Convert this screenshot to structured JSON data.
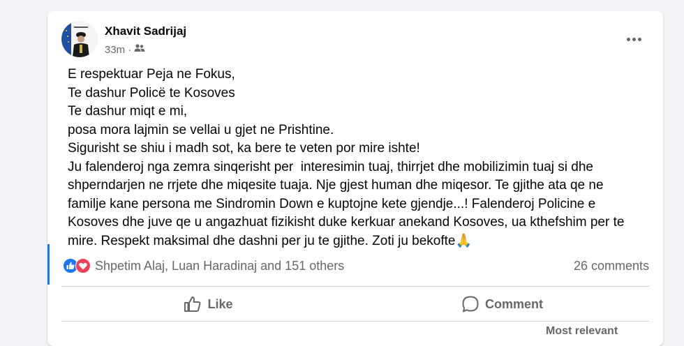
{
  "post": {
    "author": "Xhavit Sadrijaj",
    "time": "33m",
    "audience_icon": "friends-icon",
    "text_lines": [
      "E respektuar Peja ne Fokus,",
      "Te dashur Policë te Kosoves",
      "Te dashur miqt e mi,",
      "posa mora lajmin se vellai u gjet ne Prishtine.",
      "Sigurisht se shiu i madh sot, ka bere te veten por mire ishte!",
      "Ju falenderoj nga zemra sinqerisht per  interesimin tuaj, thirrjet dhe mobilizimin tuaj si dhe",
      "shperndarjen ne rrjete dhe miqesite tuaja. Nje gjest human dhe miqesor. Te gjithe ata qe ne",
      "familje kane persona me Sindromin Down e kuptojne kete gjendje...! Falenderoj Policine e",
      "Kosoves dhe juve qe u angazhuat fizikisht duke kerkuar anekand Kosoves, ua kthefshim per te",
      "mire. Respekt maksimal dhe dashni per ju te gjithe. Zoti ju bekofte🙏"
    ]
  },
  "reactions": {
    "names": "Shpetim Alaj, Luan Haradinaj and 151 others",
    "comments": "26 comments",
    "icons": [
      "like-icon",
      "love-icon"
    ]
  },
  "actions": {
    "like": "Like",
    "comment": "Comment"
  },
  "sort": {
    "label": "Most relevant"
  },
  "colors": {
    "accent": "#1877f2",
    "love": "#f33e58",
    "secondary_text": "#65676b"
  }
}
